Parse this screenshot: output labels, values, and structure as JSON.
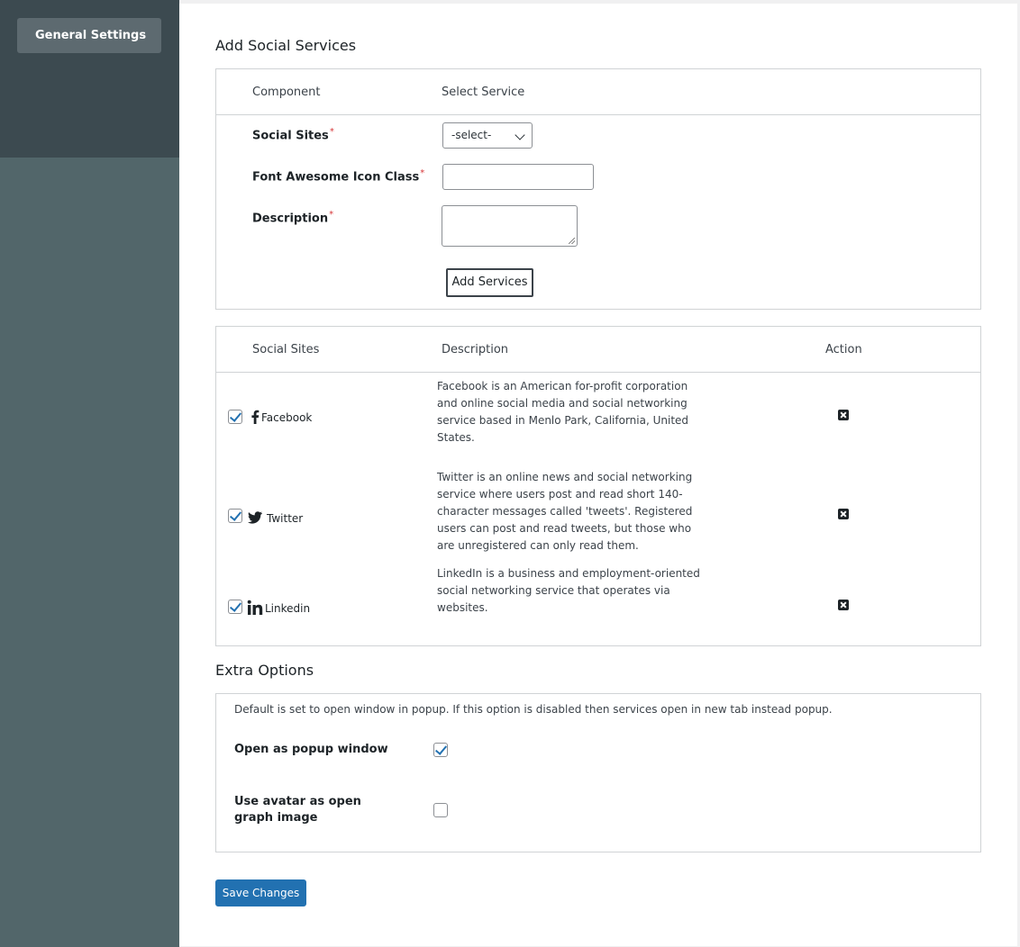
{
  "sidebar": {
    "nav_button": "General Settings"
  },
  "add_section": {
    "title": "Add Social Services",
    "col_component": "Component",
    "col_select_service": "Select Service",
    "social_sites_label": "Social Sites",
    "icon_class_label": "Font Awesome Icon Class",
    "description_label": "Description",
    "required_mark": "*",
    "select_value": "-select-",
    "add_button": "Add Services"
  },
  "services_table": {
    "col_sites": "Social Sites",
    "col_description": "Description",
    "col_action": "Action",
    "rows": [
      {
        "name": "Facebook",
        "icon": "facebook-icon",
        "checked": true,
        "description": "Facebook is an American for-profit corporation and online social media and social networking service based in Menlo Park, California, United States."
      },
      {
        "name": "Twitter",
        "icon": "twitter-icon",
        "checked": true,
        "description": "Twitter is an online news and social networking service where users post and read short 140-character messages called 'tweets'. Registered users can post and read tweets, but those who are unregistered can only read them."
      },
      {
        "name": "Linkedin",
        "icon": "linkedin-icon",
        "checked": true,
        "description": "LinkedIn is a business and employment-oriented social networking service that operates via websites."
      }
    ]
  },
  "extra": {
    "title": "Extra Options",
    "note": "Default is set to open window in popup. If this option is disabled then services open in new tab instead popup.",
    "popup_label": "Open as popup window",
    "popup_checked": true,
    "avatar_label": "Use avatar as open graph image",
    "avatar_checked": false
  },
  "save_button": "Save Changes",
  "colors": {
    "sidebar": "#52666a",
    "sidebar_top": "#3c4a50",
    "primary": "#2271b1",
    "required": "#d63638"
  }
}
